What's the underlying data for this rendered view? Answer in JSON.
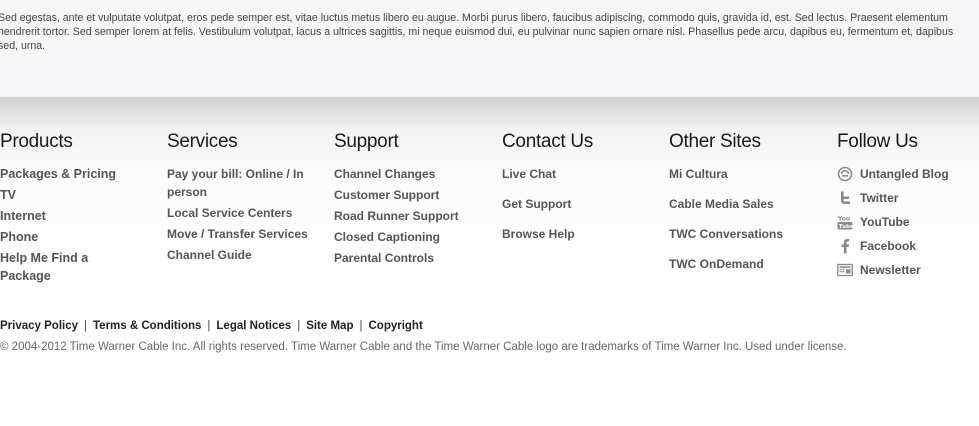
{
  "intro": {
    "text": "Sed egestas, ante et vulputate volutpat, eros pede semper est, vitae luctus metus libero eu augue. Morbi purus libero, faucibus adipiscing, commodo quis, gravida id, est. Sed lectus. Praesent elementum hendrerit tortor. Sed semper lorem at felis. Vestibulum volutpat, lacus a ultrices sagittis, mi neque euismod dui, eu pulvinar nunc sapien ornare nisl. Phasellus pede arcu, dapibus eu, fermentum et, dapibus sed, urna."
  },
  "products": {
    "heading": "Products",
    "items": [
      "Packages & Pricing",
      "TV",
      "Internet",
      "Phone",
      "Help Me Find a Package"
    ]
  },
  "services": {
    "heading": "Services",
    "items": [
      "Pay your bill: Online / In person",
      "Local Service Centers",
      "Move / Transfer Services",
      "Channel Guide"
    ]
  },
  "support": {
    "heading": "Support",
    "items": [
      "Channel Changes",
      "Customer Support",
      "Road Runner Support",
      "Closed Captioning",
      "Parental Controls"
    ]
  },
  "contact": {
    "heading": "Contact Us",
    "items": [
      "Live Chat",
      "Get Support",
      "Browse Help"
    ]
  },
  "other_sites": {
    "heading": "Other Sites",
    "items": [
      "Mi Cultura",
      "Cable Media Sales",
      "TWC Conversations",
      "TWC OnDemand"
    ]
  },
  "follow": {
    "heading": "Follow Us",
    "items": [
      {
        "label": "Untangled Blog",
        "icon": "blog-icon"
      },
      {
        "label": "Twitter",
        "icon": "twitter-icon"
      },
      {
        "label": "YouTube",
        "icon": "youtube-icon"
      },
      {
        "label": "Facebook",
        "icon": "facebook-icon"
      },
      {
        "label": "Newsletter",
        "icon": "newsletter-icon"
      }
    ]
  },
  "legal_links": [
    "Privacy Policy",
    "Terms & Conditions",
    "Legal Notices",
    "Site Map",
    "Copyright"
  ],
  "copyright": "© 2004-2012 Time Warner Cable Inc. All rights reserved. Time Warner Cable and the Time Warner Cable logo are trademarks of Time Warner Inc. Used under license."
}
